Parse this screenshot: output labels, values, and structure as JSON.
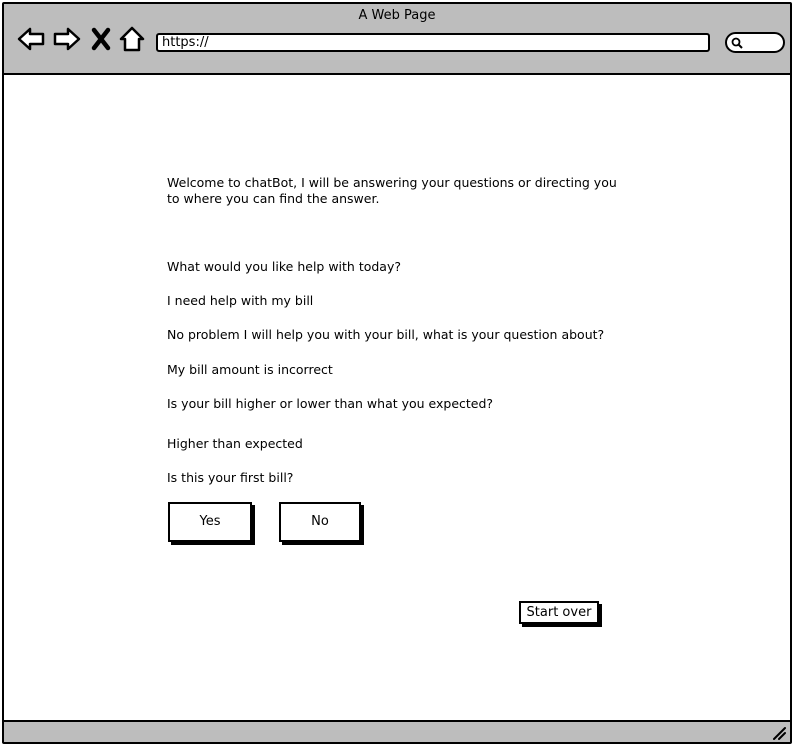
{
  "window": {
    "title": "A Web Page"
  },
  "toolbar": {
    "back_icon": "back-arrow-icon",
    "forward_icon": "forward-arrow-icon",
    "stop_icon": "close-icon",
    "home_icon": "home-icon",
    "address_value": "https://",
    "search_icon": "search-icon"
  },
  "chat": {
    "messages": [
      "Welcome to chatBot, I will be answering your questions or directing you to where you can find the answer.",
      "What would you like help with today?",
      "I need help with my bill",
      "No problem I will help you with your bill, what is your question about?",
      "My bill amount is incorrect",
      "Is your bill higher or lower than what you expected?",
      "Higher than expected",
      "Is this your first bill?"
    ],
    "yes_label": "Yes",
    "no_label": "No",
    "start_over_label": "Start over"
  },
  "colors": {
    "chrome": "#bdbdbd",
    "border": "#000000",
    "background": "#ffffff"
  }
}
